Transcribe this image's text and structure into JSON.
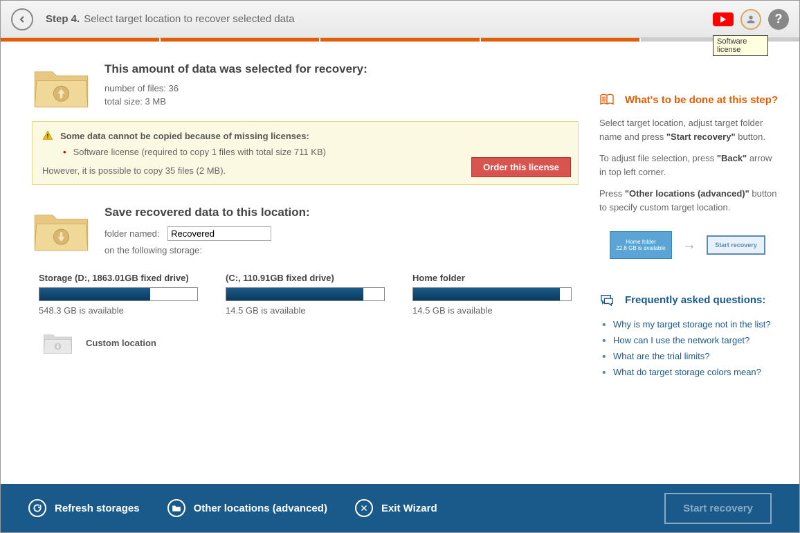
{
  "header": {
    "step_label": "Step 4.",
    "step_desc": "Select target location to recover selected data",
    "tooltip": "Software license"
  },
  "summary": {
    "title": "This amount of data was selected for recovery:",
    "files": "number of files: 36",
    "size": "total size: 3 MB"
  },
  "warning": {
    "title": "Some data cannot be copied because of missing licenses:",
    "item": "Software license (required to copy 1 files with total size 711 KB)",
    "however": "However, it is possible to copy 35 files (2 MB).",
    "order_btn": "Order this license"
  },
  "save": {
    "title": "Save recovered data to this location:",
    "folder_label": "folder named:",
    "folder_value": "Recovered",
    "storage_hint": "on the following storage:"
  },
  "storages": [
    {
      "name": "Storage (D:, 1863.01GB fixed drive)",
      "fill": 70,
      "avail": "548.3 GB is available"
    },
    {
      "name": "(C:, 110.91GB fixed drive)",
      "fill": 87,
      "avail": "14.5 GB is available"
    },
    {
      "name": "Home folder",
      "fill": 93,
      "avail": "14.5 GB is available"
    }
  ],
  "custom_location": "Custom location",
  "side": {
    "heading1": "What's to be done at this step?",
    "p1_a": "Select target location, adjust target folder name and press ",
    "p1_b": "\"Start recovery\"",
    "p1_c": " button.",
    "p2_a": "To adjust file selection, press ",
    "p2_b": "\"Back\"",
    "p2_c": " arrow in top left corner.",
    "p3_a": "Press ",
    "p3_b": "\"Other locations (advanced)\"",
    "p3_c": " button to specify custom target location.",
    "demo1a": "Home folder",
    "demo1b": "22.8 GB is available",
    "demo2": "Start recovery",
    "heading2": "Frequently asked questions:",
    "faq": [
      "Why is my target storage not in the list?",
      "How can I use the network target?",
      "What are the trial limits?",
      "What do target storage colors mean?"
    ]
  },
  "footer": {
    "refresh": "Refresh storages",
    "other": "Other locations (advanced)",
    "exit": "Exit Wizard",
    "start": "Start recovery"
  }
}
